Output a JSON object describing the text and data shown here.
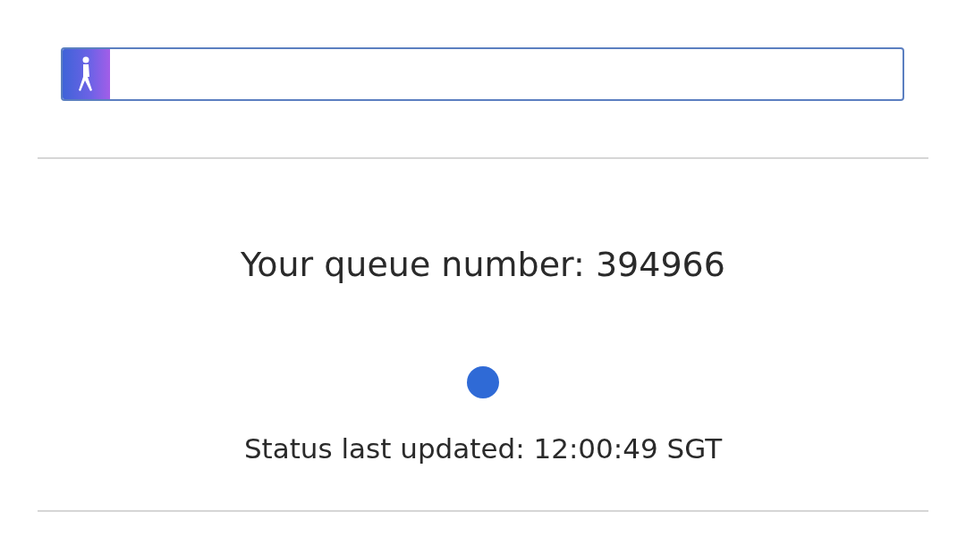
{
  "queue_progress": {
    "level": 0.056
  },
  "queue_number": {
    "label": "Your queue number: 394966"
  },
  "status": {
    "text": "Status last updated: 12:00:49 SGT"
  }
}
